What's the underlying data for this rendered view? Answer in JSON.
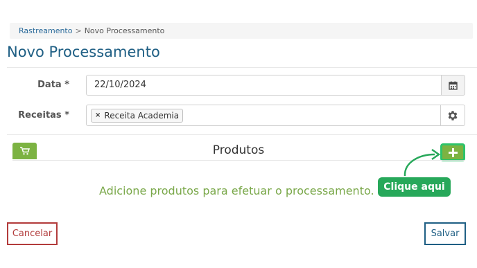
{
  "breadcrumb": {
    "root": "Rastreamento",
    "separator": ">",
    "current": "Novo Processamento"
  },
  "page": {
    "title": "Novo Processamento"
  },
  "form": {
    "date": {
      "label": "Data *",
      "value": "22/10/2024",
      "icon": "calendar-icon"
    },
    "recipes": {
      "label": "Receitas *",
      "tags": [
        {
          "remove": "×",
          "text": "Receita Academia"
        }
      ],
      "icon": "gear-icon"
    }
  },
  "products": {
    "title": "Produtos",
    "cart_icon": "cart-icon",
    "add_icon": "plus-icon",
    "empty_message": "Adicione produtos para efetuar o processamento.",
    "hint": "Clique aqui"
  },
  "actions": {
    "cancel": "Cancelar",
    "save": "Salvar"
  },
  "colors": {
    "primary": "#1f5f84",
    "green": "#7cb342",
    "hint_green": "#27a85a",
    "danger": "#b23b3b"
  }
}
